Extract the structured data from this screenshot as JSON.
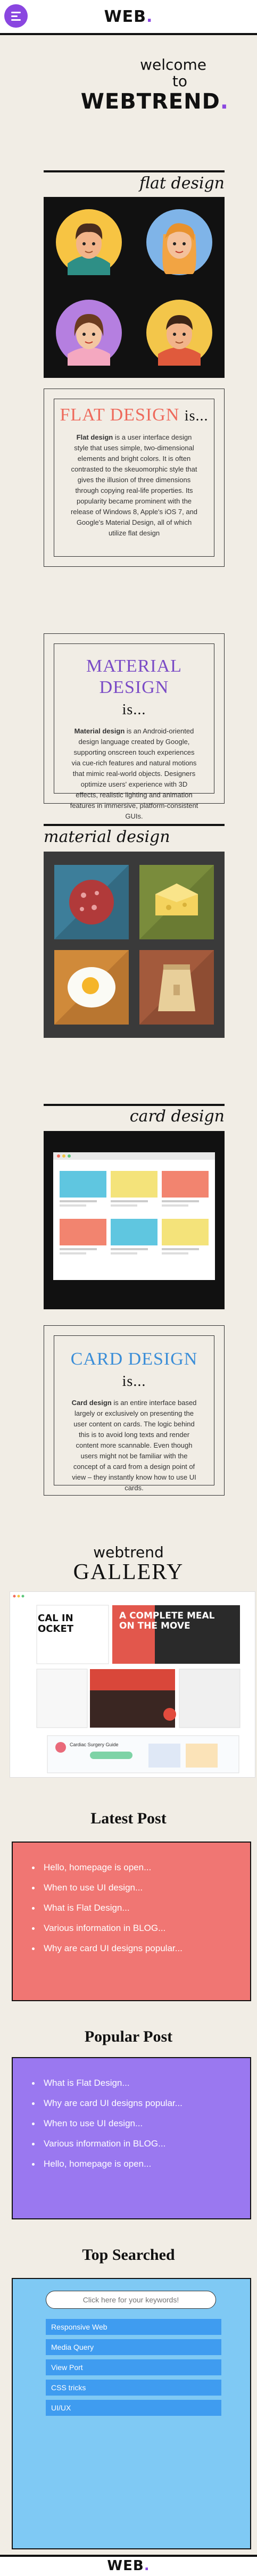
{
  "header": {
    "logo_text": "WEB",
    "logo_dot": "."
  },
  "welcome": {
    "line1": "welcome",
    "line2": "to",
    "line3": "WEBTREND",
    "dot": "."
  },
  "flat": {
    "title": "flat design",
    "heading": "FLAT DESIGN",
    "heading_suffix": "is...",
    "text_bold": "Flat design",
    "text": " is a user interface design style that uses simple, two-dimensional elements and bright colors. It is often contrasted to the skeuomorphic style that gives the illusion of three dimensions through copying real-life properties. Its popularity became prominent with the release of Windows 8, Apple's iOS 7, and Google's Material Design, all of which utilize flat design"
  },
  "material": {
    "title": "material design",
    "heading": "MATERIAL DESIGN",
    "heading_suffix": "is...",
    "text_bold": "Material design",
    "text": " is an Android-oriented design language created by Google, supporting onscreen touch experiences via cue-rich features and natural motions that mimic real-world objects. Designers optimize users' experience with 3D effects, realistic lighting and animation features in immersive, platform-consistent GUIs."
  },
  "card": {
    "title": "card design",
    "heading": "CARD DESIGN",
    "heading_suffix": "is...",
    "text_bold": "Card design",
    "text": " is an entire interface based largely or exclusively on presenting the user content on cards. The logic behind this is to avoid long texts and render content more scannable. Even though users might not be familiar with the concept of a card from a design point of view – they instantly know how to use UI cards."
  },
  "gallery": {
    "small": "webtrend",
    "big": "GALLERY",
    "tiles": {
      "headline_left": "CAL IN OCKET",
      "headline_right": "A COMPLETE MEAL ON THE MOVE",
      "sub_label": "Cardiac Surgery Guide"
    }
  },
  "latest": {
    "title": "Latest Post",
    "items": [
      "Hello, homepage is open...",
      "When to use UI design...",
      "What is Flat Design...",
      "Various information in BLOG...",
      "Why are card UI designs popular..."
    ]
  },
  "popular": {
    "title": "Popular Post",
    "items": [
      "What is Flat Design...",
      "Why are card UI designs popular...",
      "When to use UI design...",
      "Various information in BLOG...",
      "Hello, homepage is open..."
    ]
  },
  "search": {
    "title": "Top Searched",
    "placeholder": "Click here for your keywords!",
    "items": [
      "Responsive Web",
      "Media Query",
      "View Port",
      "CSS tricks",
      "UI/UX"
    ]
  },
  "footer": {
    "logo_text": "WEB",
    "logo_dot": "."
  },
  "colors": {
    "accent": "#8a46e0",
    "flat_heading": "#ee6a5c",
    "material_heading": "#7a4bc6",
    "card_heading": "#3b8ed8",
    "latest_bg": "#f07673",
    "popular_bg": "#9a78f0",
    "search_bg": "#7fc9f4"
  }
}
